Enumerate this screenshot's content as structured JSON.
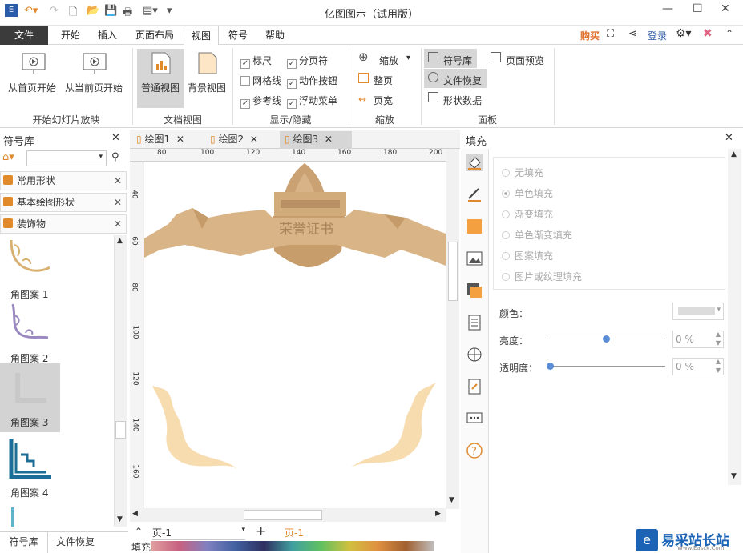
{
  "app_title": "亿图图示（试用版）",
  "menu": {
    "file": "文件",
    "tabs": [
      "开始",
      "插入",
      "页面布局",
      "视图",
      "符号",
      "帮助"
    ],
    "right": {
      "buy": "购买",
      "login": "登录"
    }
  },
  "ribbon": {
    "slideshow": {
      "from_first": "从首页开始",
      "from_current": "从当前页开始",
      "group": "开始幻灯片放映"
    },
    "docview": {
      "normal": "普通视图",
      "background": "背景视图",
      "group": "文档视图"
    },
    "showhide": {
      "ruler": "标尺",
      "grid": "网格线",
      "guide": "参考线",
      "page_break": "分页符",
      "action_btn": "动作按钮",
      "float_menu": "浮动菜单",
      "group": "显示/隐藏"
    },
    "zoom": {
      "zoom": "缩放",
      "full_page": "整页",
      "page_width": "页宽",
      "group": "缩放"
    },
    "panels": {
      "symbol_lib": "符号库",
      "file_recover": "文件恢复",
      "shape_data": "形状数据",
      "page_preview": "页面预览",
      "group": "面板"
    }
  },
  "left_panel": {
    "title": "符号库",
    "categories": [
      "常用形状",
      "基本绘图形状",
      "装饰物"
    ],
    "items": [
      "角图案 1",
      "角图案 2",
      "角图案 3",
      "角图案 4"
    ]
  },
  "doc_tabs": [
    "绘图1",
    "绘图2",
    "绘图3"
  ],
  "ruler_h": [
    "80",
    "100",
    "120",
    "140",
    "160",
    "180",
    "200"
  ],
  "ruler_v": [
    "40",
    "60",
    "80",
    "100",
    "120",
    "140",
    "160"
  ],
  "canvas": {
    "banner_text": "荣誉证书"
  },
  "page_bar": {
    "page_select": "页-1",
    "current_page": "页-1"
  },
  "fill_label": "填充",
  "right_panel": {
    "title": "填充",
    "fill_options": [
      "无填充",
      "单色填充",
      "渐变填充",
      "单色渐变填充",
      "图案填充",
      "图片或纹理填充"
    ],
    "color_label": "颜色：",
    "brightness_label": "亮度：",
    "brightness_value": "0 %",
    "transparency_label": "透明度：",
    "transparency_value": "0 %"
  },
  "bottom_tabs": [
    "符号库",
    "文件恢复"
  ],
  "watermark": {
    "text": "易采站长站",
    "sub": "Www.Easck.Com"
  }
}
